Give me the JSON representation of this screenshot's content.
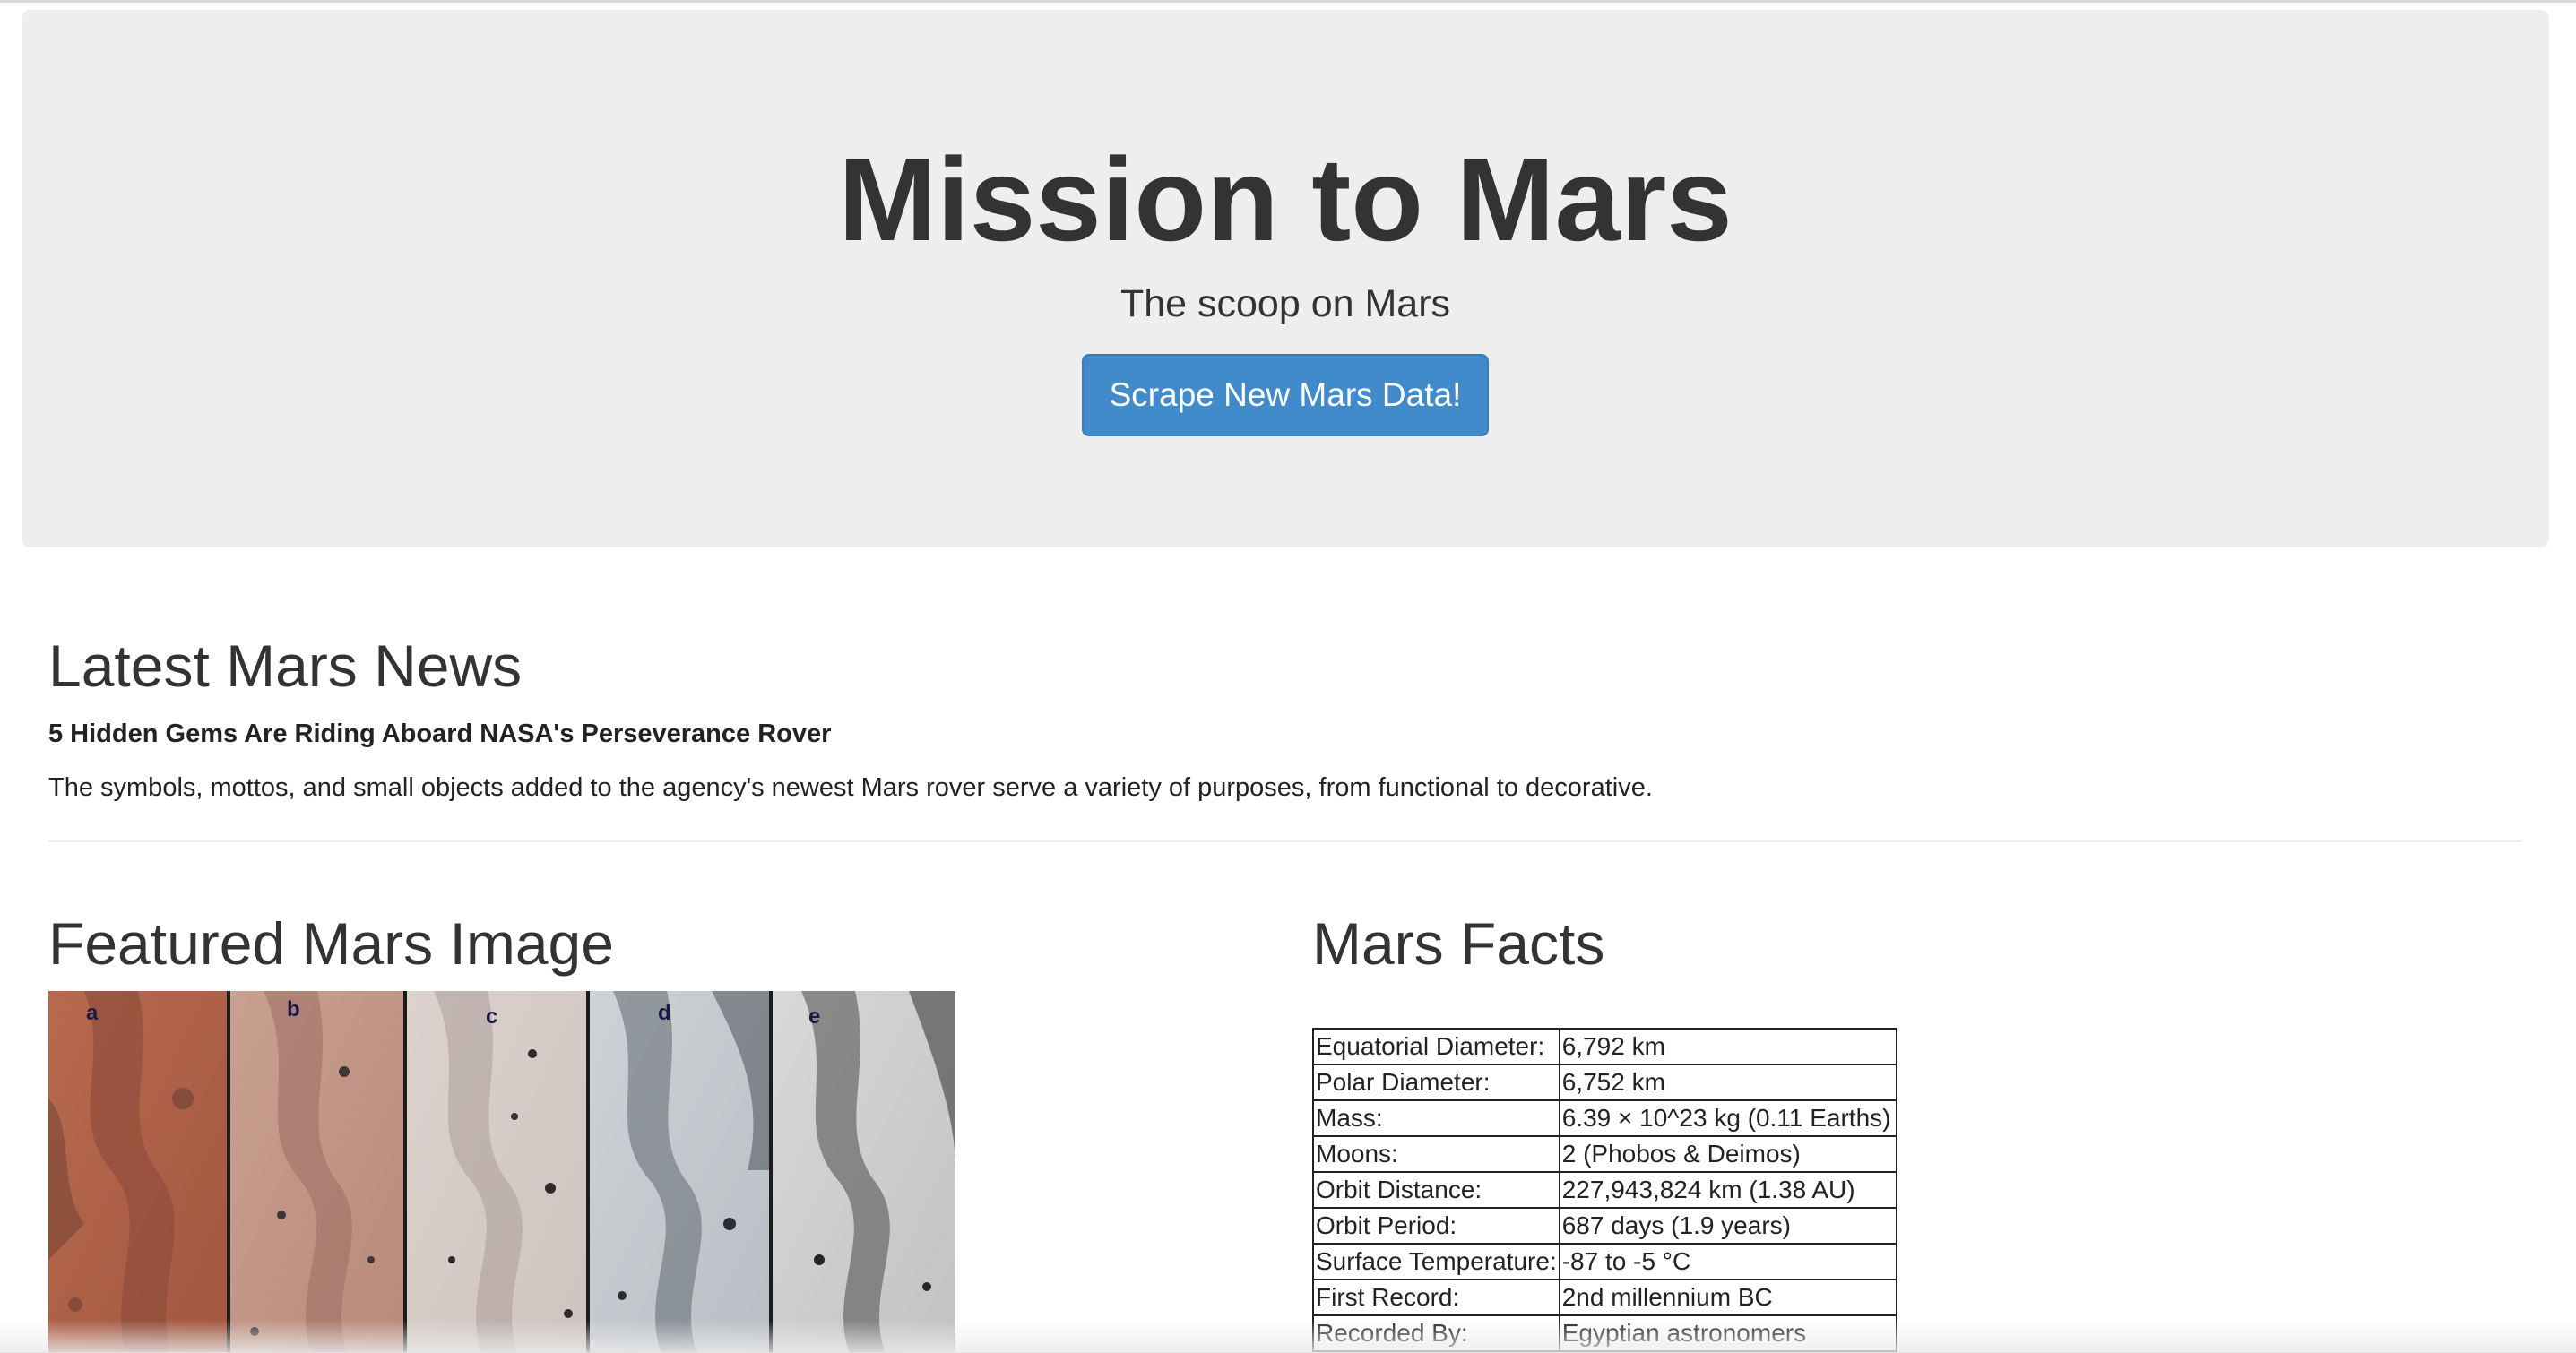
{
  "jumbotron": {
    "title": "Mission to Mars",
    "subtitle": "The scoop on Mars",
    "button_label": "Scrape New Mars Data!"
  },
  "news": {
    "heading": "Latest Mars News",
    "title": "5 Hidden Gems Are Riding Aboard NASA's Perseverance Rover",
    "teaser": "The symbols, mottos, and small objects added to the agency's newest Mars rover serve a variety of purposes, from functional to decorative."
  },
  "featured": {
    "heading": "Featured Mars Image",
    "panel_labels": [
      "a",
      "b",
      "c",
      "d",
      "e"
    ]
  },
  "facts": {
    "heading": "Mars Facts",
    "rows": [
      {
        "label": "Equatorial Diameter:",
        "value": "6,792 km"
      },
      {
        "label": "Polar Diameter:",
        "value": "6,752 km"
      },
      {
        "label": "Mass:",
        "value": "6.39 × 10^23 kg (0.11 Earths)"
      },
      {
        "label": "Moons:",
        "value": "2 (Phobos & Deimos)"
      },
      {
        "label": "Orbit Distance:",
        "value": "227,943,824 km (1.38 AU)"
      },
      {
        "label": "Orbit Period:",
        "value": "687 days (1.9 years)"
      },
      {
        "label": "Surface Temperature:",
        "value": "-87 to -5 °C"
      },
      {
        "label": "First Record:",
        "value": "2nd millennium BC"
      },
      {
        "label": "Recorded By:",
        "value": "Egyptian astronomers"
      }
    ]
  },
  "colors": {
    "jumbotron_bg": "#eeeeee",
    "button_bg": "#428bca",
    "text": "#333333"
  }
}
